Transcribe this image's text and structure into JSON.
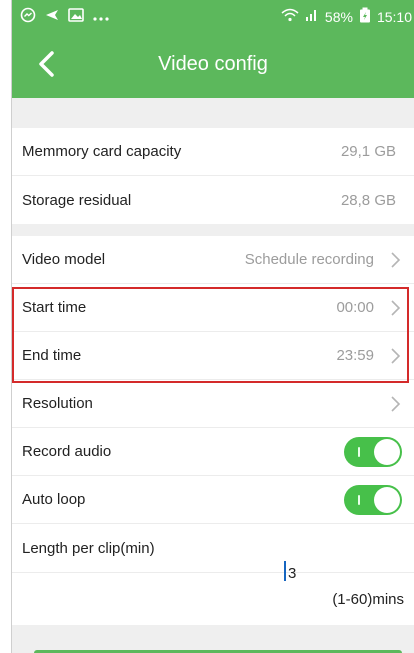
{
  "status_bar": {
    "battery": "58%",
    "time": "15:10"
  },
  "toolbar": {
    "title": "Video config"
  },
  "storage": [
    {
      "label": "Memmory card capacity",
      "value": "29,1 GB"
    },
    {
      "label": "Storage residual",
      "value": "28,8 GB"
    }
  ],
  "settings": {
    "video_model": {
      "label": "Video model",
      "value": "Schedule recording"
    },
    "start_time": {
      "label": "Start time",
      "value": "00:00"
    },
    "end_time": {
      "label": "End time",
      "value": "23:59"
    },
    "resolution": {
      "label": "Resolution",
      "value": ""
    },
    "record_audio": {
      "label": "Record audio",
      "on": true
    },
    "auto_loop": {
      "label": "Auto loop",
      "on": true
    }
  },
  "clip": {
    "label": "Length per clip(min)",
    "value": "3",
    "range_hint": "(1-60)mins"
  },
  "colors": {
    "header": "#5cb85c",
    "switch_on": "#47c04a",
    "highlight_border": "#d42a2a"
  }
}
